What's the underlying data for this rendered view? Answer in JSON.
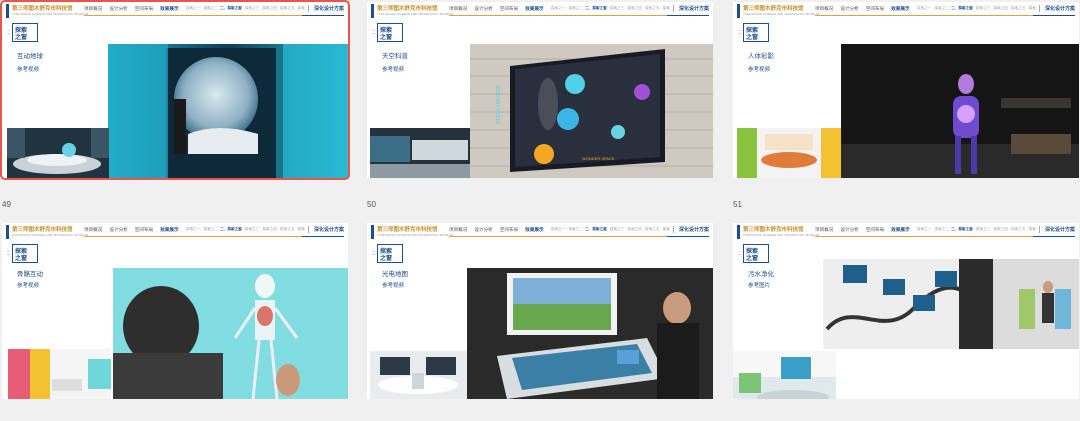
{
  "header": {
    "title": "第三师图木舒克市科技馆",
    "subtitle": "TUMUSHUKE SCIENCE AND TECHNOLOGY MUSEUM",
    "nav": [
      "项目概况",
      "设计分析",
      "空间布局",
      "效果展示"
    ],
    "crumbs_prefix": "探索之一 · 探索之二 ·",
    "crumbs_current": "二、探索之窗",
    "crumbs_suffix": " · 探索之三 · 探索之四 · 探索之五 · 探索",
    "right_label": "深化设计方案"
  },
  "section": {
    "line1": "探索",
    "line2": "之窗",
    "side": "二"
  },
  "slides": [
    {
      "item": "互动地球",
      "ref": "参考视频",
      "number": "49"
    },
    {
      "item": "天空科普",
      "ref": "参考视频",
      "number": "50"
    },
    {
      "item": "人体彩影",
      "ref": "参考视频",
      "number": "51"
    },
    {
      "item": "骨骼互动",
      "ref": "参考视频",
      "number": ""
    },
    {
      "item": "光电地图",
      "ref": "参考视频",
      "number": ""
    },
    {
      "item": "污水净化",
      "ref": "参考图片",
      "number": ""
    }
  ],
  "mockup_text": {
    "label_left": "DEMO VERSION",
    "label_bottom": "WONDER SPACE"
  }
}
